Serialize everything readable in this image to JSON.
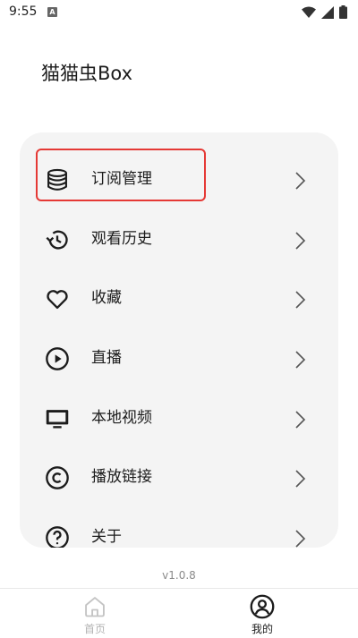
{
  "status_bar": {
    "time": "9:55",
    "notification_letter": "A"
  },
  "header": {
    "title": "猫猫虫Box"
  },
  "menu": {
    "items": [
      {
        "label": "订阅管理",
        "icon": "database-icon"
      },
      {
        "label": "观看历史",
        "icon": "history-icon"
      },
      {
        "label": "收藏",
        "icon": "heart-icon"
      },
      {
        "label": "直播",
        "icon": "play-circle-icon"
      },
      {
        "label": "本地视频",
        "icon": "monitor-icon"
      },
      {
        "label": "播放链接",
        "icon": "copyright-icon"
      },
      {
        "label": "关于",
        "icon": "help-circle-icon"
      }
    ]
  },
  "footer": {
    "version": "v1.0.8"
  },
  "bottom_nav": {
    "items": [
      {
        "label": "首页",
        "icon": "home-icon",
        "active": false
      },
      {
        "label": "我的",
        "icon": "user-circle-icon",
        "active": true
      }
    ]
  },
  "colors": {
    "highlight": "#e53935",
    "card_background": "#f4f4f4",
    "inactive_nav": "#b3b3b3"
  }
}
